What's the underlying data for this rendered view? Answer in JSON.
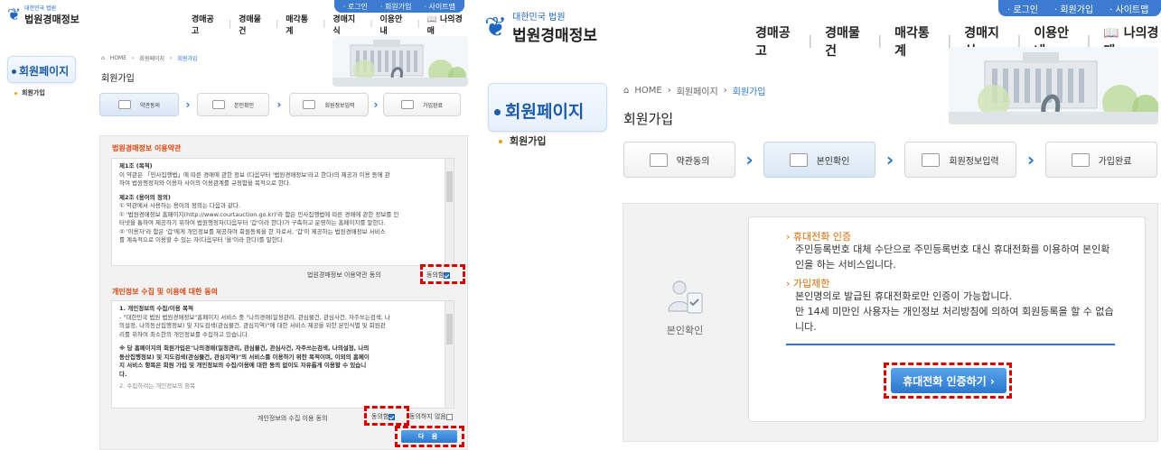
{
  "util": {
    "login": "· 로그인",
    "join": "· 회원가입",
    "sitemap": "· 사이트맵"
  },
  "logo": {
    "sub": "대한민국 법원",
    "name": "법원경매정보"
  },
  "gnb": [
    "경매공고",
    "경매물건",
    "매각통계",
    "경매지식",
    "이용안내",
    "나의경매"
  ],
  "gnb_sep": "|",
  "lnb": {
    "title": "회원페이지",
    "sub": "회원가입"
  },
  "breadcrumb": {
    "home": "HOME",
    "sep": "›",
    "level1": "회원페이지",
    "current": "회원가입"
  },
  "page_title": "회원가입",
  "steps": [
    "약관동의",
    "본인확인",
    "회원정보입력",
    "가입완료"
  ],
  "step_arrow": "›",
  "left": {
    "terms_heading": "법원경매정보 이용약관",
    "terms_lines": [
      "제1조 (목적)",
      "이 약관은 「민사집행법」에 따른 경매에 관한 정보 (다음부터 '법원경매정보'라고 한다)의 제공과 이용 등에 관",
      "하여 법원행정처와 이용자 사이의 이용관계를 규정함을 목적으로 한다.",
      "제2조 (용어의 정의)",
      "① 약관에서 사용하는 용어의 정의는 다음과 같다.",
      "① '법원경매정보 홈페이지(http://www.courtauction.go.kr)'라 함은 민사집행법에 따른 경매에 관한 정보를 인",
      "터넷을 통하여 제공하기 위하여 법원행정처(다음부터 '갑'이라 한다)가 구축하고 운영하는 홈페이지를 말한다.",
      "② '이용자'라 함은 '갑'에게 개인정보를 제공하여 회원등록을 한 자로서, '갑'이 제공하는 법원경매정보 서비스",
      "를 계속적으로 이용할 수 있는 자(다음부터 '을'이라 한다)를 말한다."
    ],
    "terms_agree_label": "법원경매정보 이용약관 동의",
    "agree": "동의함",
    "privacy_heading": "개인정보 수집 및 이용에 대한 동의",
    "privacy_lines": [
      "1. 개인정보의 수집/이용 목적",
      "- \"대한민국 법원 법원경매정보\"홈페이지 서비스 중 \"나의경매(일정관리, 관심물건, 관심사건, 자주쓰는검색, 나",
      "의설정, 나의동산집행정보) 및 지도검색(관심물건, 관심지역)\"에 대한 서비스 제공을 위한 본인식별 및 회원관",
      "리를 위하여 최소한의 개인정보를 수집하고 있습니다.",
      "※ 당 홈페이지의 회원가입은\"나의경매(일정관리, 관심물건, 관심사건, 자주쓰는검색, 나의설정, 나의",
      "동산집행정보) 및 지도검색(관심물건, 관심지역)\"의 서비스를 이용하기 위한 목적이며, 이외의 홈페이",
      "지 서비스 항목은 회원 가입 및 개인정보의 수집/이용에 대한 동의 없이도 자유롭게 이용할 수 있습니",
      "다.",
      "2. 수집하려는 개인정보의 항목"
    ],
    "privacy_agree_label": "개인정보의 수집 이용 동의",
    "disagree": "동의하지 않음",
    "next": "다 음"
  },
  "right": {
    "cert_label": "본인확인",
    "phone_heading": "› 휴대전화 인증",
    "phone_text": [
      "주민등록번호 대체 수단으로 주민등록번호 대신 휴대전화를 이용하여 본인확",
      "인을 하는 서비스입니다."
    ],
    "limit_heading": "› 가입제한",
    "limit_text": [
      "본인명의로 발급된 휴대전화로만 인증이 가능합니다.",
      "만 14세 미만인 사용자는 개인정보 처리방침에 의하여 회원등록을 할 수 없습",
      "니다."
    ],
    "phone_button": "휴대전화 인증하기 ›"
  },
  "colors": {
    "accent": "#2a77cf",
    "highlight": "#d90000",
    "bullet": "#e06a00"
  },
  "icons": [
    "home-icon",
    "book-icon",
    "building-illustration",
    "certification-icon"
  ]
}
